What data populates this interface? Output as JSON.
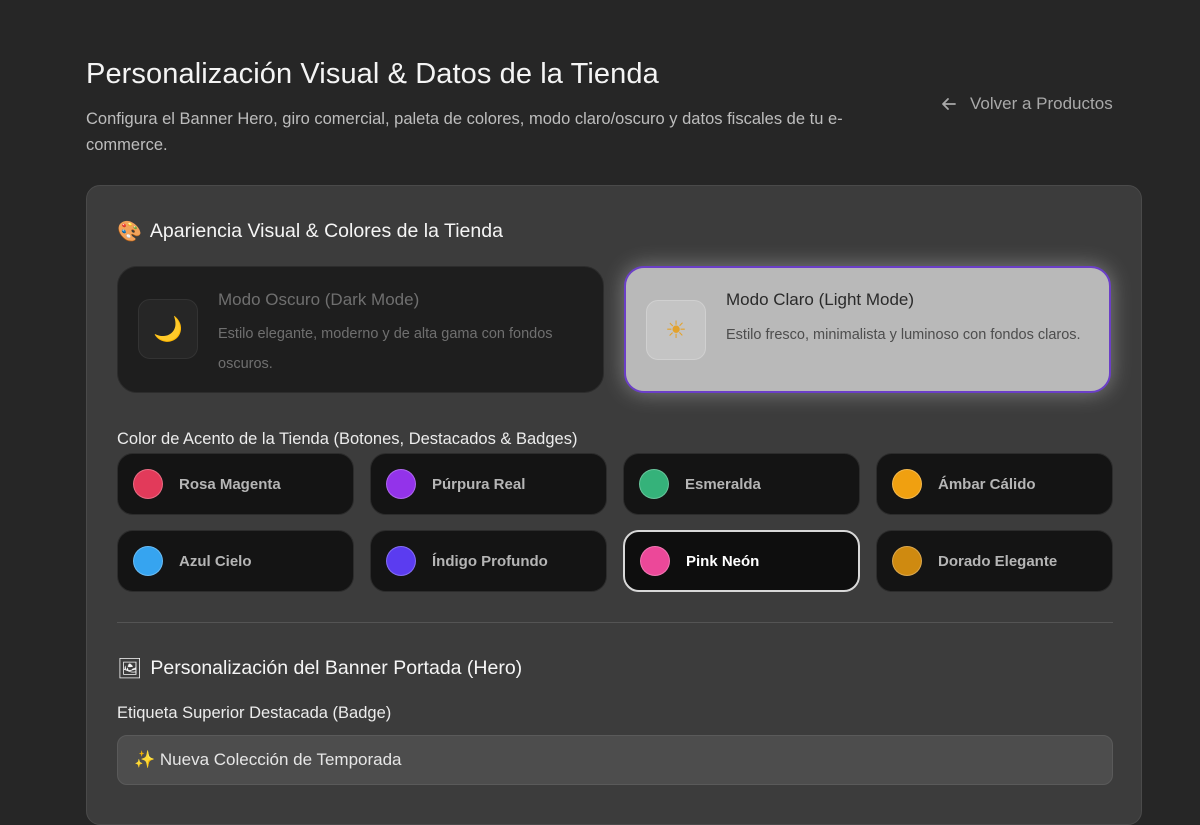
{
  "header": {
    "title": "Personalización Visual & Datos de la Tienda",
    "subtitle": "Configura el Banner Hero, giro comercial, paleta de colores, modo claro/oscuro y datos fiscales de tu e-commerce.",
    "back_label": "Volver a Productos"
  },
  "appearance": {
    "emoji": "🎨",
    "title": "Apariencia Visual & Colores de la Tienda",
    "modes": [
      {
        "icon": "moon-icon",
        "glyph": "🌙",
        "name": "Modo Oscuro (Dark Mode)",
        "description": "Estilo elegante, moderno y de alta gama con fondos oscuros.",
        "selected": false
      },
      {
        "icon": "sun-icon",
        "glyph": "☀",
        "name": "Modo Claro (Light Mode)",
        "description": "Estilo fresco, minimalista y luminoso con fondos claros.",
        "selected": true
      }
    ],
    "accent_label": "Color de Acento de la Tienda (Botones, Destacados & Badges)",
    "accents": [
      {
        "name": "Rosa Magenta",
        "color": "#e23a5a",
        "selected": false
      },
      {
        "name": "Púrpura Real",
        "color": "#9333ea",
        "selected": false
      },
      {
        "name": "Esmeralda",
        "color": "#35b27a",
        "selected": false
      },
      {
        "name": "Ámbar Cálido",
        "color": "#f0a010",
        "selected": false
      },
      {
        "name": "Azul Cielo",
        "color": "#36a4f0",
        "selected": false
      },
      {
        "name": "Índigo Profundo",
        "color": "#5b3cf0",
        "selected": false
      },
      {
        "name": "Pink Neón",
        "color": "#ec4899",
        "selected": true
      },
      {
        "name": "Dorado Elegante",
        "color": "#cf8a10",
        "selected": false
      }
    ]
  },
  "banner": {
    "emoji": "🖼",
    "title": "Personalización del Banner Portada (Hero)",
    "badge_label": "Etiqueta Superior Destacada (Badge)",
    "badge_value": "✨ Nueva Colección de Temporada"
  }
}
